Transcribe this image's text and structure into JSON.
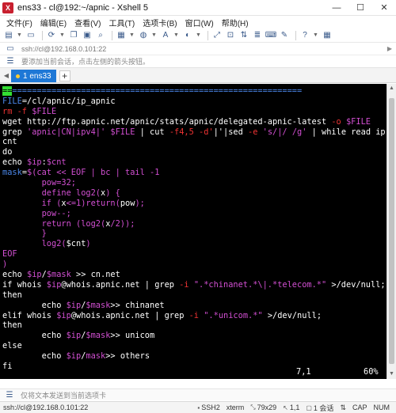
{
  "window": {
    "title": "ens33 - cl@192:~/apnic - Xshell 5",
    "minimize": "—",
    "maximize": "☐",
    "close": "✕"
  },
  "menu": [
    "文件(F)",
    "编辑(E)",
    "查看(V)",
    "工具(T)",
    "选项卡(B)",
    "窗口(W)",
    "帮助(H)"
  ],
  "address": {
    "text": "ssh://cl@192.168.0.101:22"
  },
  "hint": {
    "text": "要添加当前会话，点击左侧的箭头按钮。"
  },
  "tabs": [
    {
      "label": "1 ens33"
    }
  ],
  "tab_add": "+",
  "terminal": {
    "lines": [
      [
        [
          "cur",
          "=="
        ],
        [
          "b",
          "==========================================================="
        ]
      ],
      [
        [
          "b",
          "FILE"
        ],
        [
          "w",
          "=/cl/apnic/ip_apnic"
        ]
      ],
      [
        [
          "r",
          "rm -f "
        ],
        [
          "m",
          "$FILE"
        ]
      ],
      [
        [
          "w",
          "wget http://ftp.apnic.net/apnic/stats/apnic/delegated-apnic-latest "
        ],
        [
          "r",
          "-o "
        ],
        [
          "m",
          "$FILE"
        ]
      ],
      [
        [
          "w",
          "grep "
        ],
        [
          "m",
          "'apnic|CN|ipv4|'"
        ],
        [
          "w",
          " "
        ],
        [
          "m",
          "$FILE"
        ],
        [
          "w",
          " | cut "
        ],
        [
          "r",
          "-f4,5 -d'"
        ],
        [
          "w",
          "|'|sed "
        ],
        [
          "r",
          "-e "
        ],
        [
          "m",
          "'s/|/ /g'"
        ],
        [
          "w",
          " | while read ip"
        ]
      ],
      [
        [
          "w",
          "cnt"
        ]
      ],
      [
        [
          "w",
          "do"
        ]
      ],
      [
        [
          "w",
          "echo "
        ],
        [
          "m",
          "$ip"
        ],
        [
          "w",
          ":"
        ],
        [
          "m",
          "$cnt"
        ]
      ],
      [
        [
          "b",
          "mask"
        ],
        [
          "w",
          "="
        ],
        [
          "m",
          "$(cat << EOF | bc | tail -1"
        ]
      ],
      [
        [
          "w",
          "        "
        ],
        [
          "m",
          "pow=32;"
        ]
      ],
      [
        [
          "w",
          "        "
        ],
        [
          "m",
          "define log2("
        ],
        [
          "w",
          "x"
        ],
        [
          "m",
          ") {"
        ]
      ],
      [
        [
          "w",
          "        "
        ],
        [
          "m",
          "if ("
        ],
        [
          "w",
          "x"
        ],
        [
          "m",
          "<=1)return("
        ],
        [
          "w",
          "pow"
        ],
        [
          "m",
          ");"
        ]
      ],
      [
        [
          "w",
          "        "
        ],
        [
          "m",
          "pow--;"
        ]
      ],
      [
        [
          "w",
          "        "
        ],
        [
          "m",
          "return (log2("
        ],
        [
          "w",
          "x"
        ],
        [
          "m",
          "/2));"
        ]
      ],
      [
        [
          "w",
          "        "
        ],
        [
          "m",
          "}"
        ]
      ],
      [
        [
          "w",
          "        "
        ],
        [
          "m",
          "log2("
        ],
        [
          "w",
          "$cnt"
        ],
        [
          "m",
          ")"
        ]
      ],
      [
        [
          "m",
          "EOF"
        ]
      ],
      [
        [
          "m",
          ")"
        ]
      ],
      [
        [
          "w",
          "echo "
        ],
        [
          "m",
          "$ip"
        ],
        [
          "w",
          "/"
        ],
        [
          "m",
          "$mask"
        ],
        [
          "w",
          " >> cn.net"
        ]
      ],
      [
        [
          "w",
          "if whois "
        ],
        [
          "m",
          "$ip"
        ],
        [
          "w",
          "@whois.apnic.net | grep "
        ],
        [
          "r",
          "-i "
        ],
        [
          "m",
          "\".*chinanet.*\\|.*telecom.*\""
        ],
        [
          "w",
          " >/dev/null;"
        ]
      ],
      [
        [
          "w",
          "then"
        ]
      ],
      [
        [
          "w",
          "        echo "
        ],
        [
          "m",
          "$ip"
        ],
        [
          "w",
          "/"
        ],
        [
          "m",
          "$mask"
        ],
        [
          "w",
          ">> chinanet"
        ]
      ],
      [
        [
          "w",
          "elif whois "
        ],
        [
          "m",
          "$ip"
        ],
        [
          "w",
          "@whois.apnic.net | grep "
        ],
        [
          "r",
          "-i "
        ],
        [
          "m",
          "\".*unicom.*\""
        ],
        [
          "w",
          " >/dev/null;"
        ]
      ],
      [
        [
          "w",
          "then"
        ]
      ],
      [
        [
          "w",
          "        echo "
        ],
        [
          "m",
          "$ip"
        ],
        [
          "w",
          "/"
        ],
        [
          "m",
          "$mask"
        ],
        [
          "w",
          ">> unicom"
        ]
      ],
      [
        [
          "w",
          "else"
        ]
      ],
      [
        [
          "w",
          "        echo "
        ],
        [
          "m",
          "$ip"
        ],
        [
          "w",
          "/"
        ],
        [
          "m",
          "mask"
        ],
        [
          "w",
          ">> others"
        ]
      ],
      [
        [
          "w",
          "fi"
        ]
      ]
    ],
    "cursor_position": "7,1",
    "scroll_percent": "60%"
  },
  "sendbar": {
    "text": "仅将文本发送到当前选项卡"
  },
  "statusbar": {
    "connection": "ssh://cl@192.168.0.101:22",
    "protocol": "SSH2",
    "terminal_type": "xterm",
    "size": "79x29",
    "position": "1,1",
    "sessions": "1 会话",
    "cap": "CAP",
    "num": "NUM"
  },
  "colors": {
    "tab_active": "#1e78d6",
    "terminal_bg": "#000000",
    "cursor": "#33dd33",
    "keyword_blue": "#4a86e8",
    "option_red": "#ee3333",
    "string_magenta": "#d24fd2"
  }
}
